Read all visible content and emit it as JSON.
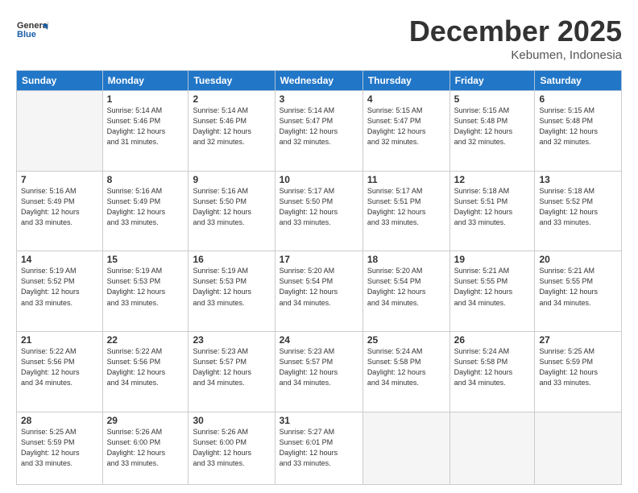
{
  "header": {
    "logo_line1": "General",
    "logo_line2": "Blue",
    "month": "December 2025",
    "location": "Kebumen, Indonesia"
  },
  "weekdays": [
    "Sunday",
    "Monday",
    "Tuesday",
    "Wednesday",
    "Thursday",
    "Friday",
    "Saturday"
  ],
  "weeks": [
    [
      {
        "day": "",
        "info": ""
      },
      {
        "day": "1",
        "info": "Sunrise: 5:14 AM\nSunset: 5:46 PM\nDaylight: 12 hours\nand 31 minutes."
      },
      {
        "day": "2",
        "info": "Sunrise: 5:14 AM\nSunset: 5:46 PM\nDaylight: 12 hours\nand 32 minutes."
      },
      {
        "day": "3",
        "info": "Sunrise: 5:14 AM\nSunset: 5:47 PM\nDaylight: 12 hours\nand 32 minutes."
      },
      {
        "day": "4",
        "info": "Sunrise: 5:15 AM\nSunset: 5:47 PM\nDaylight: 12 hours\nand 32 minutes."
      },
      {
        "day": "5",
        "info": "Sunrise: 5:15 AM\nSunset: 5:48 PM\nDaylight: 12 hours\nand 32 minutes."
      },
      {
        "day": "6",
        "info": "Sunrise: 5:15 AM\nSunset: 5:48 PM\nDaylight: 12 hours\nand 32 minutes."
      }
    ],
    [
      {
        "day": "7",
        "info": "Sunrise: 5:16 AM\nSunset: 5:49 PM\nDaylight: 12 hours\nand 33 minutes."
      },
      {
        "day": "8",
        "info": "Sunrise: 5:16 AM\nSunset: 5:49 PM\nDaylight: 12 hours\nand 33 minutes."
      },
      {
        "day": "9",
        "info": "Sunrise: 5:16 AM\nSunset: 5:50 PM\nDaylight: 12 hours\nand 33 minutes."
      },
      {
        "day": "10",
        "info": "Sunrise: 5:17 AM\nSunset: 5:50 PM\nDaylight: 12 hours\nand 33 minutes."
      },
      {
        "day": "11",
        "info": "Sunrise: 5:17 AM\nSunset: 5:51 PM\nDaylight: 12 hours\nand 33 minutes."
      },
      {
        "day": "12",
        "info": "Sunrise: 5:18 AM\nSunset: 5:51 PM\nDaylight: 12 hours\nand 33 minutes."
      },
      {
        "day": "13",
        "info": "Sunrise: 5:18 AM\nSunset: 5:52 PM\nDaylight: 12 hours\nand 33 minutes."
      }
    ],
    [
      {
        "day": "14",
        "info": "Sunrise: 5:19 AM\nSunset: 5:52 PM\nDaylight: 12 hours\nand 33 minutes."
      },
      {
        "day": "15",
        "info": "Sunrise: 5:19 AM\nSunset: 5:53 PM\nDaylight: 12 hours\nand 33 minutes."
      },
      {
        "day": "16",
        "info": "Sunrise: 5:19 AM\nSunset: 5:53 PM\nDaylight: 12 hours\nand 33 minutes."
      },
      {
        "day": "17",
        "info": "Sunrise: 5:20 AM\nSunset: 5:54 PM\nDaylight: 12 hours\nand 34 minutes."
      },
      {
        "day": "18",
        "info": "Sunrise: 5:20 AM\nSunset: 5:54 PM\nDaylight: 12 hours\nand 34 minutes."
      },
      {
        "day": "19",
        "info": "Sunrise: 5:21 AM\nSunset: 5:55 PM\nDaylight: 12 hours\nand 34 minutes."
      },
      {
        "day": "20",
        "info": "Sunrise: 5:21 AM\nSunset: 5:55 PM\nDaylight: 12 hours\nand 34 minutes."
      }
    ],
    [
      {
        "day": "21",
        "info": "Sunrise: 5:22 AM\nSunset: 5:56 PM\nDaylight: 12 hours\nand 34 minutes."
      },
      {
        "day": "22",
        "info": "Sunrise: 5:22 AM\nSunset: 5:56 PM\nDaylight: 12 hours\nand 34 minutes."
      },
      {
        "day": "23",
        "info": "Sunrise: 5:23 AM\nSunset: 5:57 PM\nDaylight: 12 hours\nand 34 minutes."
      },
      {
        "day": "24",
        "info": "Sunrise: 5:23 AM\nSunset: 5:57 PM\nDaylight: 12 hours\nand 34 minutes."
      },
      {
        "day": "25",
        "info": "Sunrise: 5:24 AM\nSunset: 5:58 PM\nDaylight: 12 hours\nand 34 minutes."
      },
      {
        "day": "26",
        "info": "Sunrise: 5:24 AM\nSunset: 5:58 PM\nDaylight: 12 hours\nand 34 minutes."
      },
      {
        "day": "27",
        "info": "Sunrise: 5:25 AM\nSunset: 5:59 PM\nDaylight: 12 hours\nand 33 minutes."
      }
    ],
    [
      {
        "day": "28",
        "info": "Sunrise: 5:25 AM\nSunset: 5:59 PM\nDaylight: 12 hours\nand 33 minutes."
      },
      {
        "day": "29",
        "info": "Sunrise: 5:26 AM\nSunset: 6:00 PM\nDaylight: 12 hours\nand 33 minutes."
      },
      {
        "day": "30",
        "info": "Sunrise: 5:26 AM\nSunset: 6:00 PM\nDaylight: 12 hours\nand 33 minutes."
      },
      {
        "day": "31",
        "info": "Sunrise: 5:27 AM\nSunset: 6:01 PM\nDaylight: 12 hours\nand 33 minutes."
      },
      {
        "day": "",
        "info": ""
      },
      {
        "day": "",
        "info": ""
      },
      {
        "day": "",
        "info": ""
      }
    ]
  ]
}
